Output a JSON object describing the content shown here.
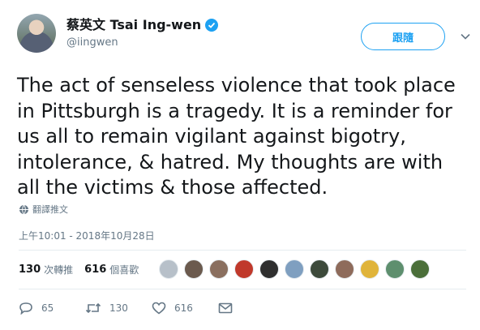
{
  "author": {
    "display_name": "蔡英文 Tsai Ing-wen",
    "handle": "@iingwen"
  },
  "follow_button_label": "跟隨",
  "tweet": {
    "text": "The act of senseless violence that took place in Pittsburgh is a tragedy. It is a reminder for us all to remain vigilant against bigotry, intolerance, & hatred. My thoughts are with all the victims & those affected.",
    "translate_label": "翻譯推文",
    "timestamp": "上午10:01 - 2018年10月28日"
  },
  "stats": {
    "retweet_count": "130",
    "retweet_label": "次轉推",
    "like_count": "616",
    "like_label": "個喜歡"
  },
  "actions": {
    "reply_count": "65",
    "retweet_count": "130",
    "like_count": "616"
  },
  "colors": {
    "accent": "#1da1f2",
    "muted": "#657786",
    "divider": "#e6ecf0"
  },
  "likers": [
    {
      "color": "#b7c0c9"
    },
    {
      "color": "#6b5a4e"
    },
    {
      "color": "#8a6f5f"
    },
    {
      "color": "#c0392b"
    },
    {
      "color": "#2f2f2f"
    },
    {
      "color": "#7f9fc0"
    },
    {
      "color": "#3d4a3b"
    },
    {
      "color": "#8e6b5b"
    },
    {
      "color": "#e0b43a"
    },
    {
      "color": "#5e8f6e"
    },
    {
      "color": "#4b6f3a"
    }
  ]
}
